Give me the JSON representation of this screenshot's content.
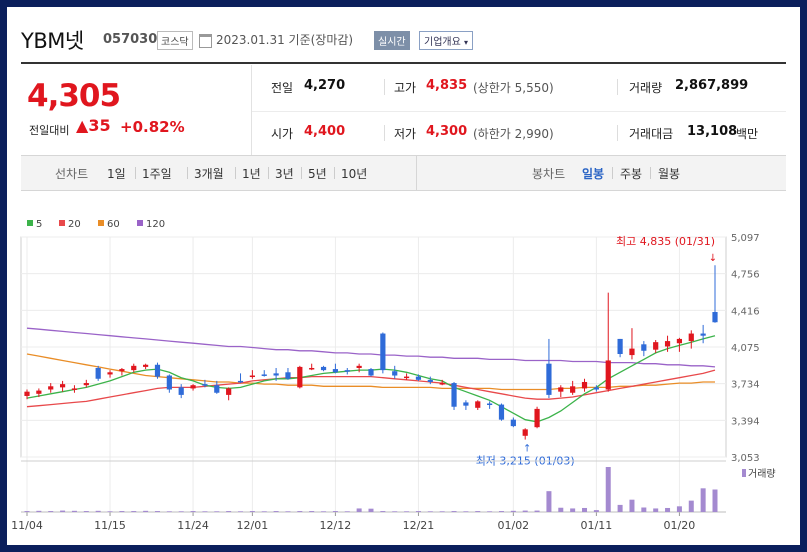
{
  "header": {
    "name": "YBM넷",
    "code": "057030",
    "market": "코스닥",
    "date": "2023.01.31",
    "date_note": "기준(장마감)",
    "realtime_btn": "실시간",
    "company_btn": "기업개요"
  },
  "quote": {
    "price": "4,305",
    "compare_label": "전일대비",
    "change": "35",
    "change_pct": "+0.82%"
  },
  "stats": {
    "prev_label": "전일",
    "prev": "4,270",
    "high_label": "고가",
    "high": "4,835",
    "upper_limit": "(상한가 5,550)",
    "volume_label": "거래량",
    "volume": "2,867,899",
    "open_label": "시가",
    "open": "4,400",
    "low_label": "저가",
    "low": "4,300",
    "lower_limit": "(하한가 2,990)",
    "amount_label": "거래대금",
    "amount": "13,108",
    "amount_unit": "백만"
  },
  "tabs": {
    "line_label": "선차트",
    "periods": [
      "1일",
      "1주일",
      "3개월",
      "1년",
      "3년",
      "5년",
      "10년"
    ],
    "candle_label": "봉차트",
    "candle": [
      "일봉",
      "주봉",
      "월봉"
    ],
    "active_candle": "일봉"
  },
  "chart_data": {
    "type": "candlestick",
    "legend": [
      {
        "name": "5",
        "color": "#3cb34a"
      },
      {
        "name": "20",
        "color": "#e8494b"
      },
      {
        "name": "60",
        "color": "#e98d27"
      },
      {
        "name": "120",
        "color": "#9a63c8"
      }
    ],
    "y_ticks": [
      "5,097",
      "4,756",
      "4,416",
      "4,075",
      "3,734",
      "3,394",
      "3,053"
    ],
    "ylim": [
      3053,
      5097
    ],
    "x_tick_labels": [
      {
        "label": "11/04",
        "index": 0
      },
      {
        "label": "11/15",
        "index": 7
      },
      {
        "label": "11/24",
        "index": 14
      },
      {
        "label": "12/01",
        "index": 19
      },
      {
        "label": "12/12",
        "index": 26
      },
      {
        "label": "12/21",
        "index": 33
      },
      {
        "label": "01/02",
        "index": 41
      },
      {
        "label": "01/11",
        "index": 48
      },
      {
        "label": "01/20",
        "index": 55
      }
    ],
    "high_note": "최고 4,835 (01/31)",
    "low_note": "최저 3,215 (01/03)",
    "volume_label": "거래량",
    "candles": [
      {
        "o": 3620,
        "h": 3680,
        "l": 3590,
        "c": 3660
      },
      {
        "o": 3640,
        "h": 3690,
        "l": 3610,
        "c": 3670
      },
      {
        "o": 3680,
        "h": 3740,
        "l": 3650,
        "c": 3710
      },
      {
        "o": 3700,
        "h": 3760,
        "l": 3660,
        "c": 3730
      },
      {
        "o": 3680,
        "h": 3720,
        "l": 3650,
        "c": 3690
      },
      {
        "o": 3720,
        "h": 3770,
        "l": 3700,
        "c": 3740
      },
      {
        "o": 3880,
        "h": 3900,
        "l": 3760,
        "c": 3780
      },
      {
        "o": 3820,
        "h": 3860,
        "l": 3790,
        "c": 3840
      },
      {
        "o": 3850,
        "h": 3880,
        "l": 3810,
        "c": 3870
      },
      {
        "o": 3860,
        "h": 3920,
        "l": 3840,
        "c": 3900
      },
      {
        "o": 3890,
        "h": 3920,
        "l": 3870,
        "c": 3910
      },
      {
        "o": 3910,
        "h": 3930,
        "l": 3780,
        "c": 3800
      },
      {
        "o": 3810,
        "h": 3820,
        "l": 3650,
        "c": 3680
      },
      {
        "o": 3700,
        "h": 3730,
        "l": 3600,
        "c": 3630
      },
      {
        "o": 3690,
        "h": 3730,
        "l": 3670,
        "c": 3720
      },
      {
        "o": 3730,
        "h": 3770,
        "l": 3700,
        "c": 3720
      },
      {
        "o": 3720,
        "h": 3760,
        "l": 3640,
        "c": 3650
      },
      {
        "o": 3630,
        "h": 3700,
        "l": 3580,
        "c": 3690
      },
      {
        "o": 3760,
        "h": 3830,
        "l": 3740,
        "c": 3750
      },
      {
        "o": 3800,
        "h": 3860,
        "l": 3780,
        "c": 3810
      },
      {
        "o": 3820,
        "h": 3860,
        "l": 3800,
        "c": 3810
      },
      {
        "o": 3830,
        "h": 3880,
        "l": 3760,
        "c": 3810
      },
      {
        "o": 3840,
        "h": 3880,
        "l": 3770,
        "c": 3780
      },
      {
        "o": 3700,
        "h": 3900,
        "l": 3690,
        "c": 3890
      },
      {
        "o": 3880,
        "h": 3920,
        "l": 3860,
        "c": 3880
      },
      {
        "o": 3890,
        "h": 3900,
        "l": 3850,
        "c": 3860
      },
      {
        "o": 3870,
        "h": 3920,
        "l": 3830,
        "c": 3840
      },
      {
        "o": 3860,
        "h": 3880,
        "l": 3820,
        "c": 3850
      },
      {
        "o": 3880,
        "h": 3920,
        "l": 3840,
        "c": 3900
      },
      {
        "o": 3870,
        "h": 3880,
        "l": 3800,
        "c": 3810
      },
      {
        "o": 4200,
        "h": 4210,
        "l": 3830,
        "c": 3860
      },
      {
        "o": 3850,
        "h": 3900,
        "l": 3780,
        "c": 3810
      },
      {
        "o": 3790,
        "h": 3830,
        "l": 3770,
        "c": 3800
      },
      {
        "o": 3800,
        "h": 3820,
        "l": 3760,
        "c": 3770
      },
      {
        "o": 3770,
        "h": 3800,
        "l": 3730,
        "c": 3750
      },
      {
        "o": 3740,
        "h": 3770,
        "l": 3720,
        "c": 3740
      },
      {
        "o": 3740,
        "h": 3750,
        "l": 3490,
        "c": 3520
      },
      {
        "o": 3560,
        "h": 3580,
        "l": 3490,
        "c": 3530
      },
      {
        "o": 3510,
        "h": 3580,
        "l": 3490,
        "c": 3570
      },
      {
        "o": 3550,
        "h": 3570,
        "l": 3500,
        "c": 3540
      },
      {
        "o": 3540,
        "h": 3550,
        "l": 3390,
        "c": 3400
      },
      {
        "o": 3400,
        "h": 3420,
        "l": 3330,
        "c": 3340
      },
      {
        "o": 3250,
        "h": 3320,
        "l": 3215,
        "c": 3310
      },
      {
        "o": 3330,
        "h": 3520,
        "l": 3320,
        "c": 3500
      },
      {
        "o": 3920,
        "h": 4150,
        "l": 3600,
        "c": 3630
      },
      {
        "o": 3660,
        "h": 3720,
        "l": 3610,
        "c": 3700
      },
      {
        "o": 3650,
        "h": 3760,
        "l": 3630,
        "c": 3710
      },
      {
        "o": 3690,
        "h": 3780,
        "l": 3660,
        "c": 3750
      },
      {
        "o": 3700,
        "h": 3720,
        "l": 3660,
        "c": 3680
      },
      {
        "o": 3680,
        "h": 4580,
        "l": 3660,
        "c": 3950
      },
      {
        "o": 4150,
        "h": 4150,
        "l": 3980,
        "c": 4010
      },
      {
        "o": 4000,
        "h": 4250,
        "l": 3960,
        "c": 4060
      },
      {
        "o": 4100,
        "h": 4130,
        "l": 3990,
        "c": 4040
      },
      {
        "o": 4050,
        "h": 4140,
        "l": 4020,
        "c": 4120
      },
      {
        "o": 4080,
        "h": 4180,
        "l": 4030,
        "c": 4130
      },
      {
        "o": 4110,
        "h": 4160,
        "l": 4030,
        "c": 4150
      },
      {
        "o": 4130,
        "h": 4230,
        "l": 4060,
        "c": 4200
      },
      {
        "o": 4200,
        "h": 4280,
        "l": 4110,
        "c": 4180
      },
      {
        "o": 4400,
        "h": 4835,
        "l": 4300,
        "c": 4305
      }
    ],
    "ma5": [
      3600,
      3620,
      3640,
      3660,
      3680,
      3700,
      3730,
      3760,
      3800,
      3840,
      3860,
      3870,
      3840,
      3790,
      3760,
      3720,
      3700,
      3690,
      3700,
      3730,
      3760,
      3780,
      3780,
      3790,
      3810,
      3830,
      3840,
      3850,
      3860,
      3860,
      3870,
      3860,
      3840,
      3810,
      3780,
      3760,
      3700,
      3660,
      3620,
      3580,
      3520,
      3460,
      3400,
      3380,
      3420,
      3480,
      3560,
      3640,
      3700,
      3780,
      3840,
      3900,
      3960,
      4020,
      4060,
      4090,
      4120,
      4150,
      4180
    ],
    "ma20": [
      3520,
      3530,
      3540,
      3550,
      3560,
      3570,
      3590,
      3610,
      3630,
      3650,
      3670,
      3690,
      3700,
      3700,
      3700,
      3710,
      3720,
      3730,
      3740,
      3760,
      3770,
      3780,
      3790,
      3790,
      3800,
      3800,
      3800,
      3800,
      3800,
      3800,
      3790,
      3780,
      3770,
      3760,
      3750,
      3740,
      3720,
      3700,
      3680,
      3660,
      3640,
      3620,
      3600,
      3590,
      3590,
      3600,
      3610,
      3630,
      3650,
      3670,
      3690,
      3710,
      3730,
      3750,
      3770,
      3790,
      3810,
      3830,
      3860
    ],
    "ma60": [
      4010,
      3990,
      3970,
      3950,
      3930,
      3910,
      3890,
      3870,
      3850,
      3830,
      3810,
      3800,
      3790,
      3780,
      3770,
      3760,
      3750,
      3750,
      3740,
      3740,
      3730,
      3730,
      3720,
      3720,
      3720,
      3710,
      3710,
      3710,
      3710,
      3710,
      3700,
      3700,
      3700,
      3700,
      3700,
      3690,
      3690,
      3690,
      3690,
      3690,
      3680,
      3680,
      3680,
      3680,
      3680,
      3690,
      3690,
      3700,
      3700,
      3700,
      3710,
      3710,
      3720,
      3720,
      3730,
      3740,
      3740,
      3750,
      3750
    ],
    "ma120": [
      4250,
      4240,
      4230,
      4220,
      4210,
      4200,
      4190,
      4180,
      4170,
      4160,
      4150,
      4140,
      4130,
      4120,
      4110,
      4100,
      4090,
      4080,
      4080,
      4070,
      4060,
      4050,
      4050,
      4040,
      4040,
      4030,
      4020,
      4020,
      4010,
      4010,
      4000,
      4000,
      3990,
      3990,
      3980,
      3980,
      3970,
      3970,
      3970,
      3960,
      3960,
      3960,
      3950,
      3950,
      3950,
      3950,
      3940,
      3940,
      3940,
      3930,
      3930,
      3930,
      3920,
      3920,
      3910,
      3910,
      3900,
      3900,
      3890
    ],
    "volume": [
      40,
      50,
      40,
      60,
      50,
      40,
      50,
      30,
      40,
      40,
      50,
      40,
      30,
      30,
      40,
      30,
      30,
      40,
      30,
      40,
      30,
      40,
      30,
      40,
      40,
      30,
      40,
      30,
      150,
      140,
      40,
      30,
      30,
      40,
      30,
      30,
      40,
      30,
      40,
      30,
      40,
      50,
      60,
      60,
      880,
      180,
      150,
      170,
      80,
      1900,
      300,
      520,
      190,
      150,
      170,
      240,
      480,
      1000,
      950
    ]
  }
}
